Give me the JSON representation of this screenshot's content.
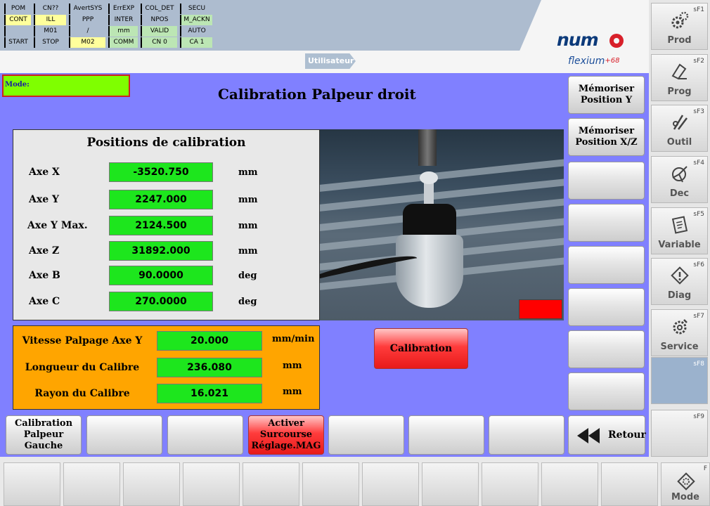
{
  "status_cells": [
    {
      "text": "POM",
      "color": ""
    },
    {
      "text": "CN??",
      "color": ""
    },
    {
      "text": "AvertSYS",
      "color": ""
    },
    {
      "text": "ErrEXP",
      "color": ""
    },
    {
      "text": "COL_DET",
      "color": ""
    },
    {
      "text": "SECU",
      "color": ""
    },
    {
      "text": "CONT",
      "color": "yellow"
    },
    {
      "text": "ILL",
      "color": "yellow"
    },
    {
      "text": "PPP",
      "color": ""
    },
    {
      "text": "INTER",
      "color": ""
    },
    {
      "text": "NPOS",
      "color": ""
    },
    {
      "text": "M_ACKN",
      "color": "green"
    },
    {
      "text": "",
      "color": ""
    },
    {
      "text": "M01",
      "color": ""
    },
    {
      "text": "/",
      "color": ""
    },
    {
      "text": "mm",
      "color": "green"
    },
    {
      "text": "VALID",
      "color": "green"
    },
    {
      "text": "AUTO",
      "color": ""
    },
    {
      "text": "START",
      "color": ""
    },
    {
      "text": "STOP",
      "color": ""
    },
    {
      "text": "M02",
      "color": "yellow"
    },
    {
      "text": "COMM",
      "color": "green"
    },
    {
      "text": "CN 0",
      "color": "green"
    },
    {
      "text": "CA 1",
      "color": "green"
    }
  ],
  "header": {
    "user_tab": "Utilisateur",
    "logo_text": "num",
    "product": "flexium",
    "product_suffix": "+68"
  },
  "main": {
    "mode_label": "Mode:",
    "page_title": "Calibration Palpeur droit",
    "positions": {
      "heading": "Positions de calibration",
      "rows": [
        {
          "label": "Axe X",
          "value": "-3520.750",
          "unit": "mm"
        },
        {
          "label": "Axe Y",
          "value": "2247.000",
          "unit": "mm"
        },
        {
          "label": "Axe Y Max.",
          "value": "2124.500",
          "unit": "mm"
        },
        {
          "label": "Axe Z",
          "value": "31892.000",
          "unit": "mm"
        },
        {
          "label": "Axe B",
          "value": "90.0000",
          "unit": "deg"
        },
        {
          "label": "Axe C",
          "value": "270.0000",
          "unit": "deg"
        }
      ]
    },
    "probe_params": [
      {
        "label": "Vitesse Palpage Axe Y",
        "value": "20.000",
        "unit": "mm/min"
      },
      {
        "label": "Longueur du Calibre",
        "value": "236.080",
        "unit": "mm"
      },
      {
        "label": "Rayon du Calibre",
        "value": "16.021",
        "unit": "mm"
      }
    ],
    "calibration_button": "Calibration",
    "side_buttons": [
      "Mémoriser Position Y",
      "Mémoriser Position X/Z",
      "",
      "",
      "",
      "",
      "",
      ""
    ],
    "bottom_buttons": [
      "Calibration Palpeur Gauche",
      "",
      "",
      "Activer Surcourse Réglage.MAG",
      "",
      "",
      ""
    ],
    "retour": "Retour"
  },
  "fkeys": [
    {
      "code": "sF1",
      "label": "Prod",
      "icon": "gears-icon"
    },
    {
      "code": "sF2",
      "label": "Prog",
      "icon": "program-edit-icon"
    },
    {
      "code": "sF3",
      "label": "Outil",
      "icon": "tool-icon"
    },
    {
      "code": "sF4",
      "label": "Dec",
      "icon": "offset-axes-icon"
    },
    {
      "code": "sF5",
      "label": "Variable",
      "icon": "variable-doc-icon"
    },
    {
      "code": "sF6",
      "label": "Diag",
      "icon": "diagnostic-icon"
    },
    {
      "code": "sF7",
      "label": "Service",
      "icon": "service-gear-icon"
    },
    {
      "code": "sF8",
      "label": "",
      "icon": ""
    },
    {
      "code": "sF9",
      "label": "",
      "icon": ""
    }
  ],
  "mode_key": {
    "code": "F",
    "label": "Mode"
  }
}
